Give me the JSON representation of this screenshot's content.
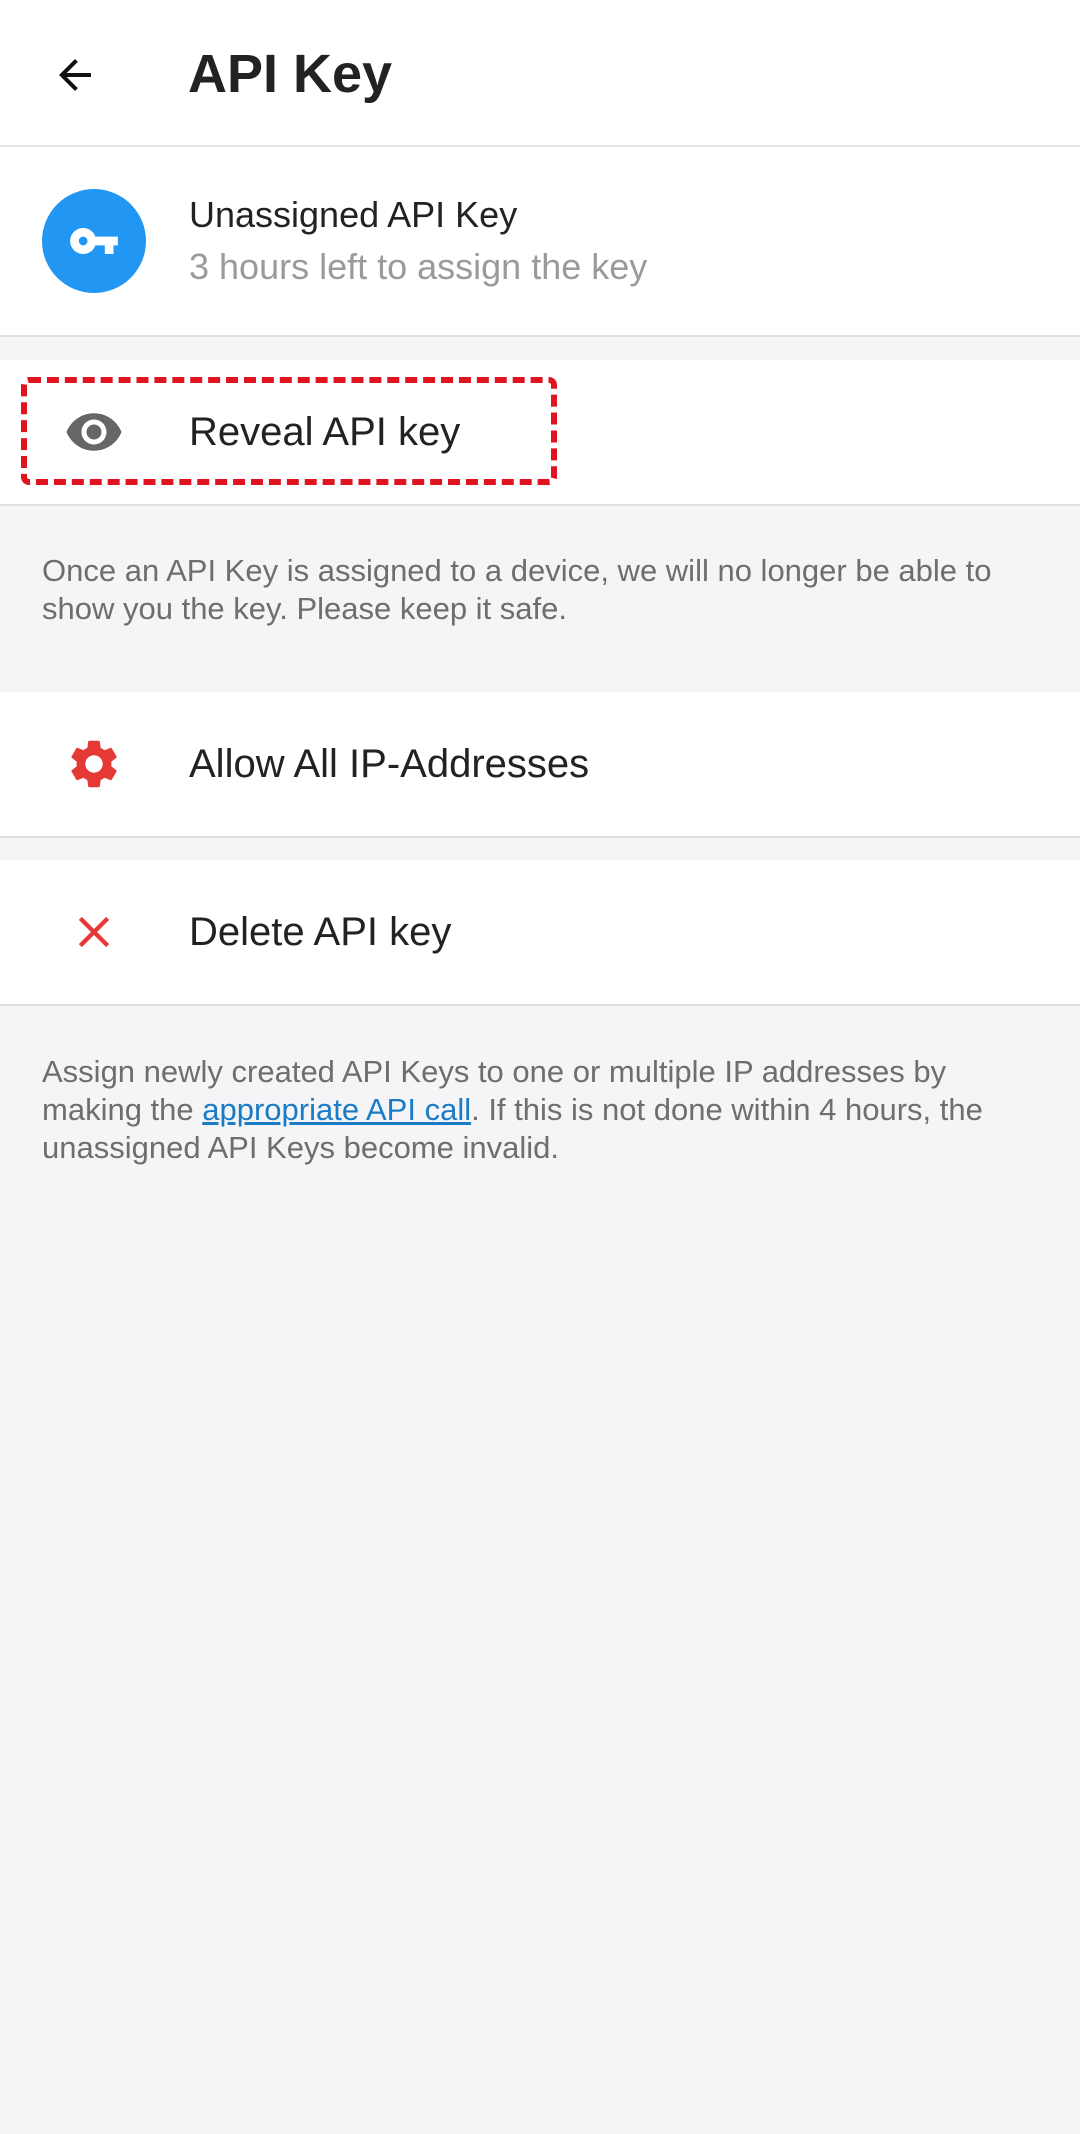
{
  "appbar": {
    "title": "API Key",
    "back_icon": "arrow-left-icon"
  },
  "key_card": {
    "icon": "key-icon",
    "icon_bg": "#2196f3",
    "title": "Unassigned API Key",
    "subtitle": "3 hours left to assign the key"
  },
  "reveal": {
    "icon": "eye-icon",
    "label": "Reveal API key",
    "highlight_color": "#e0141e"
  },
  "note1": {
    "text": "Once an API Key is assigned to a device, we will no longer be able to show you the key. Please keep it safe."
  },
  "allow": {
    "icon": "gear-icon",
    "icon_color": "#e53935",
    "label": "Allow All IP-Addresses"
  },
  "delete": {
    "icon": "close-icon",
    "icon_color": "#e53935",
    "label": "Delete API key"
  },
  "note2": {
    "before": "Assign newly created API Keys to one or multiple IP addresses by making the ",
    "link": "appropriate API call",
    "after": ". If this is not done within 4 hours, the unassigned API Keys become invalid."
  }
}
